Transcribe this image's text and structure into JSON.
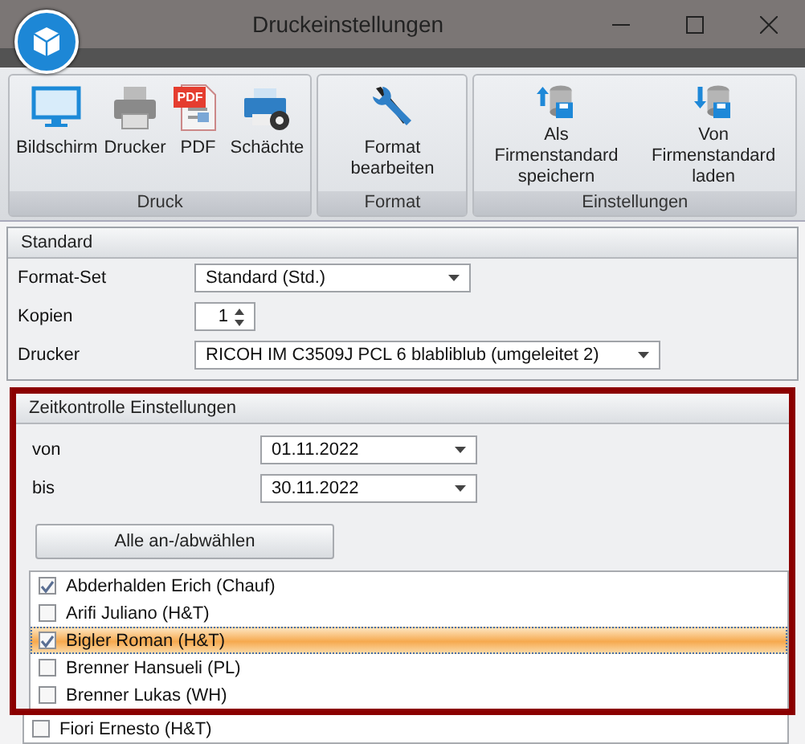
{
  "window": {
    "title": "Druckeinstellungen"
  },
  "ribbon": {
    "groups": [
      {
        "label": "Druck",
        "buttons": [
          {
            "kind": "monitor",
            "label": "Bildschirm"
          },
          {
            "kind": "printer",
            "label": "Drucker"
          },
          {
            "kind": "pdf",
            "label": "PDF",
            "badge": "PDF"
          },
          {
            "kind": "trays",
            "label": "Schächte"
          }
        ]
      },
      {
        "label": "Format",
        "buttons": [
          {
            "kind": "tools",
            "label": "Format bearbeiten"
          }
        ]
      },
      {
        "label": "Einstellungen",
        "buttons": [
          {
            "kind": "upload",
            "label": "Als Firmenstandard speichern"
          },
          {
            "kind": "download",
            "label": "Von Firmenstandard laden"
          }
        ]
      }
    ]
  },
  "standard": {
    "title": "Standard",
    "fields": [
      {
        "kind": "combo",
        "label": "Format-Set",
        "value": "Standard (Std.)"
      },
      {
        "kind": "spin",
        "label": "Kopien",
        "value": "1"
      },
      {
        "kind": "combo",
        "label": "Drucker",
        "value": "RICOH IM C3509J PCL 6 blabliblub (umgeleitet 2)"
      }
    ]
  },
  "zeitkontrolle": {
    "title": "Zeitkontrolle Einstellungen",
    "fields": [
      {
        "label": "von",
        "value": "01.11.2022"
      },
      {
        "label": "bis",
        "value": "30.11.2022"
      }
    ],
    "toggle_button": "Alle an-/abwählen",
    "employees": [
      {
        "name": "Abderhalden Erich (Chauf)",
        "checked": true,
        "selected": false
      },
      {
        "name": "Arifi Juliano (H&T)",
        "checked": false,
        "selected": false
      },
      {
        "name": "Bigler Roman (H&T)",
        "checked": true,
        "selected": true
      },
      {
        "name": "Brenner Hansueli (PL)",
        "checked": false,
        "selected": false
      },
      {
        "name": "Brenner Lukas (WH)",
        "checked": false,
        "selected": false
      },
      {
        "name": "Fiori Ernesto (H&T)",
        "checked": false,
        "selected": false
      }
    ]
  }
}
